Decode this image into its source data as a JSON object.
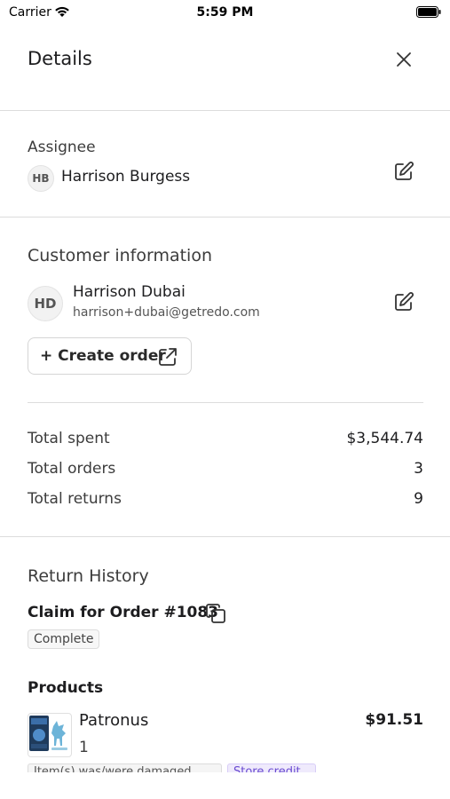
{
  "status_bar": {
    "carrier": "Carrier",
    "time": "5:59 PM",
    "wifi_icon": "wifi-icon",
    "battery_icon": "battery-icon"
  },
  "header": {
    "title": "Details",
    "close_icon": "close-icon"
  },
  "assignee": {
    "label": "Assignee",
    "initials": "HB",
    "name": "Harrison Burgess",
    "edit_icon": "edit-icon"
  },
  "customer": {
    "label": "Customer information",
    "initials": "HD",
    "name": "Harrison Dubai",
    "email": "harrison+dubai@getredo.com",
    "edit_icon": "edit-icon",
    "create_order_label": "+ Create order",
    "create_order_icon": "external-link-icon"
  },
  "stats": [
    {
      "label": "Total spent",
      "value": "$3,544.74"
    },
    {
      "label": "Total orders",
      "value": "3"
    },
    {
      "label": "Total returns",
      "value": "9"
    }
  ],
  "return_history": {
    "label": "Return History",
    "claim_title": "Claim for Order #1083",
    "copy_icon": "copy-icon",
    "status": "Complete",
    "products_heading": "Products",
    "products": [
      {
        "name": "Patronus",
        "quantity": "1",
        "price": "$91.51",
        "tags": [
          "Item(s) was/were damaged",
          "Store credit"
        ]
      }
    ]
  },
  "colors": {
    "divider": "#dcdcdc",
    "text": "#1d1d1f",
    "muted": "#3c3c3c",
    "tag_purple_bg": "#efeafc",
    "tag_purple_text": "#6a4bd1"
  }
}
